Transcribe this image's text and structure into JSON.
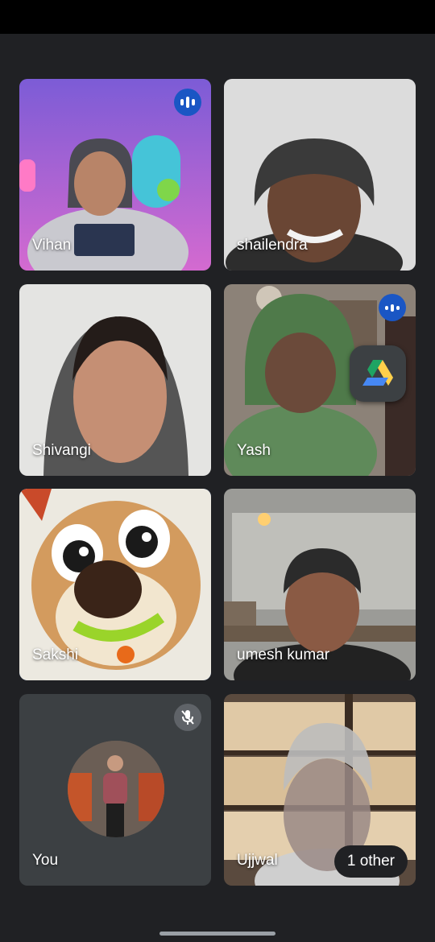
{
  "participants": [
    {
      "name": "Vihan",
      "state": "speaking-indicator"
    },
    {
      "name": "shailendra"
    },
    {
      "name": "Shivangi"
    },
    {
      "name": "Yash",
      "state": "speaking-indicator"
    },
    {
      "name": "Sakshi",
      "state": "active-speaker"
    },
    {
      "name": "umesh kumar"
    },
    {
      "name": "You",
      "state": "muted"
    },
    {
      "name": "Ujjwal"
    }
  ],
  "others_chip": "1 other",
  "colors": {
    "background": "#202124",
    "accent": "#1a56c4",
    "tile": "#3c4043"
  },
  "icons": {
    "speaking": "audio-level-icon",
    "muted": "mic-off-icon",
    "app": "google-drive-icon"
  }
}
